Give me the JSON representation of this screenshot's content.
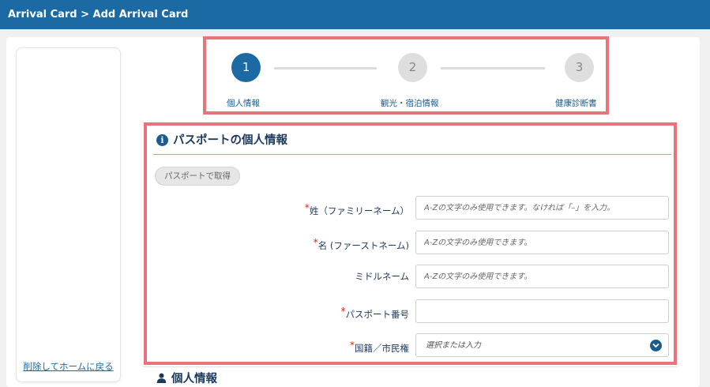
{
  "header": {
    "breadcrumb": "Arrival Card > Add Arrival Card"
  },
  "sidebar": {
    "delete_link": "削除してホームに戻る"
  },
  "stepper": {
    "steps": [
      {
        "number": "1",
        "label": "個人情報",
        "state": "active"
      },
      {
        "number": "2",
        "label": "観光・宿泊情報",
        "state": "inactive"
      },
      {
        "number": "3",
        "label": "健康診断書",
        "state": "inactive"
      }
    ]
  },
  "passport_section": {
    "title": "パスポートの個人情報",
    "icon": "info-icon",
    "get_from_passport_button": "パスポートで取得",
    "fields": [
      {
        "label": "姓（ファミリーネーム）",
        "required": true,
        "placeholder": "A-Zの文字のみ使用できます。なければ「–」を入力。",
        "value": ""
      },
      {
        "label": "名 (ファーストネーム)",
        "required": true,
        "placeholder": "A-Zの文字のみ使用できます。",
        "value": ""
      },
      {
        "label": "ミドルネーム",
        "required": false,
        "placeholder": "A-Zの文字のみ使用できます。",
        "value": ""
      },
      {
        "label": "パスポート番号",
        "required": true,
        "placeholder": "",
        "value": ""
      },
      {
        "label": "国籍／市民権",
        "required": true,
        "placeholder": "選択または入力",
        "value": ""
      }
    ],
    "required_marker": "*"
  },
  "personal_section": {
    "title": "個人情報",
    "icon": "person-icon"
  },
  "colors": {
    "header_bg": "#1b6aa3",
    "highlight_border": "#e8747a",
    "active_step": "#1b6aa3",
    "required": "#e01e1e"
  }
}
